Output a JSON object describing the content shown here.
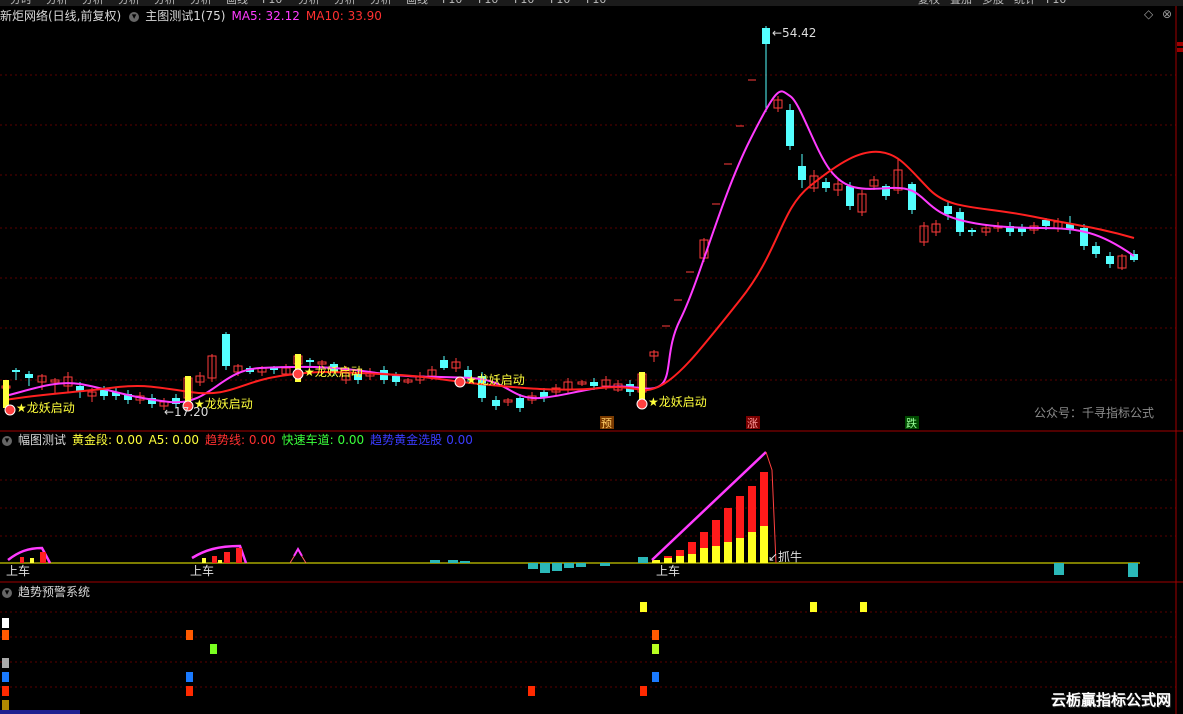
{
  "toolbar": [
    "分时",
    "分析",
    "分析",
    "分析",
    "分析",
    "分析",
    "画线",
    "F10",
    "分析",
    "分析",
    "分析",
    "画线",
    "F10",
    "F10",
    "F10",
    "F10",
    "F10"
  ],
  "toolbar_right": [
    "复权",
    "叠加",
    "多股",
    "统计",
    "F10"
  ],
  "main": {
    "stock": "新炬网络(日线,前复权)",
    "indicator": "主图测试1(75)",
    "ma5_label": "MA5: 32.12",
    "ma10_label": "MA10: 33.90",
    "high_label": "54.42",
    "low_label": "17.20",
    "signal_text": "龙妖启动",
    "tags": {
      "yu": "预",
      "zhang": "涨",
      "die": "跌"
    },
    "watermark": "公众号：千寻指标公式",
    "colors": {
      "up": "#ff3b3b",
      "down": "#54ffff",
      "ma5": "#ff3bff",
      "ma10": "#ff2020",
      "signal": "#ffff3b"
    }
  },
  "sub1": {
    "name": "幅图测试",
    "gold": "黄金段: 0.00",
    "a5": "A5: 0.00",
    "trend": "趋势线: 0.00",
    "fast": "快速车道: 0.00",
    "select": "趋势黄金选股",
    "select_val": "0.00",
    "label_shangche": "上车",
    "label_zhuaniu": "抓牛"
  },
  "sub2": {
    "name": "趋势预警系统"
  },
  "logo": "云栃贏指标公式网"
}
